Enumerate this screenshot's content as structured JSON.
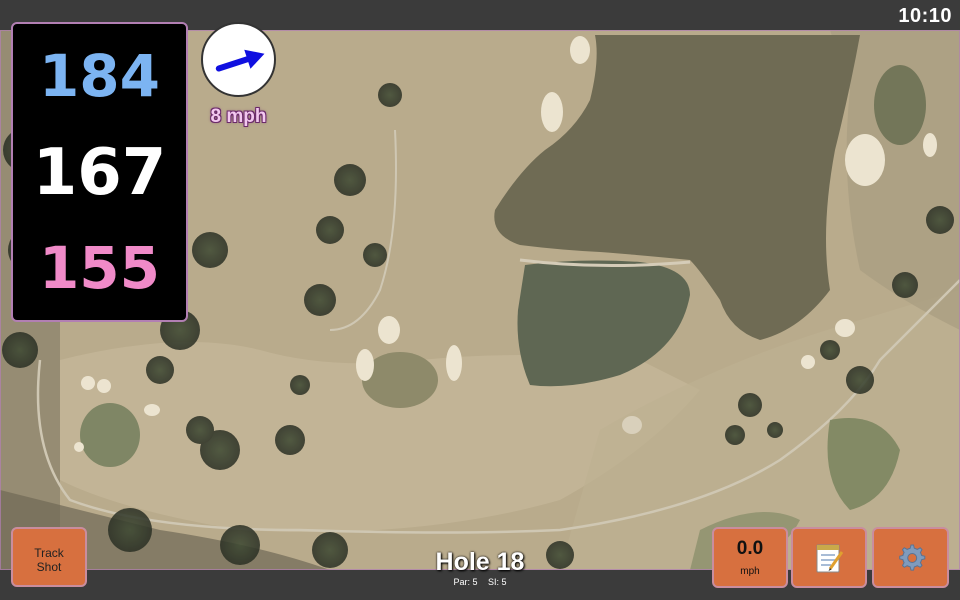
{
  "status_bar": {
    "time": "10:10"
  },
  "distances": {
    "back": {
      "value": "184",
      "color": "#7cb4f2"
    },
    "middle": {
      "value": "167",
      "color": "#ffffff"
    },
    "front": {
      "value": "155",
      "color": "#f08ac8"
    }
  },
  "wind": {
    "speed_label": "8 mph",
    "arrow_color": "#1010e0",
    "icon": "wind-direction-arrow-icon"
  },
  "buttons": {
    "track_shot": {
      "line1": "Track",
      "line2": "Shot"
    },
    "speed": {
      "value": "0.0",
      "unit": "mph"
    },
    "notes": {
      "icon": "notepad-icon"
    },
    "settings": {
      "icon": "gear-icon"
    }
  },
  "hole": {
    "title": "Hole 18",
    "par": "Par: 5",
    "si": "SI: 5"
  },
  "colors": {
    "button_bg": "#d7703f",
    "panel_border": "#b27fb3",
    "water": "#6f6b54",
    "fairway": "#b7a889"
  }
}
